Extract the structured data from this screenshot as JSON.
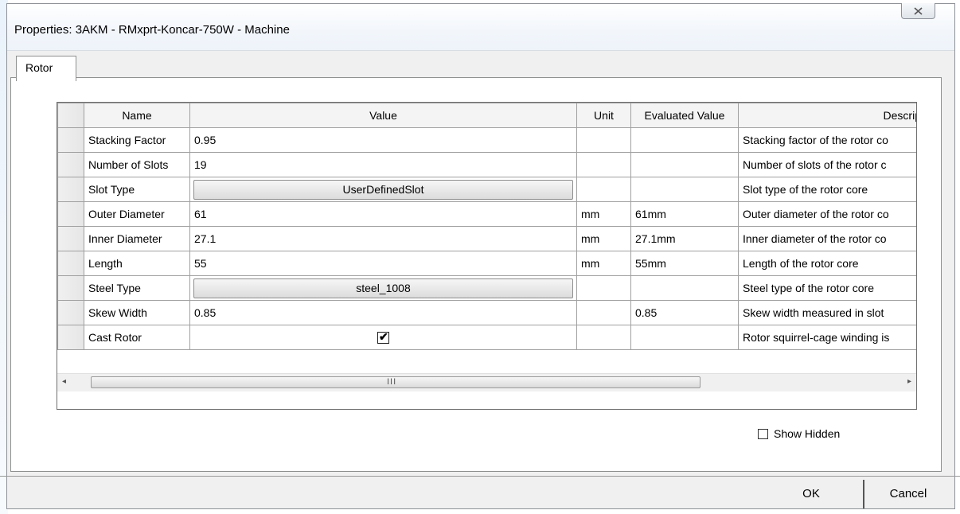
{
  "window": {
    "title": "Properties: 3AKM - RMxprt-Koncar-750W - Machine",
    "close_icon": "close-icon"
  },
  "tabs": [
    {
      "label": "Rotor",
      "active": true
    }
  ],
  "grid": {
    "columns": [
      "Name",
      "Value",
      "Unit",
      "Evaluated Value",
      "Descrip"
    ],
    "rows": [
      {
        "name": "Stacking Factor",
        "value": "0.95",
        "unit": "",
        "evaluated": "",
        "description": "Stacking factor of the rotor co"
      },
      {
        "name": "Number of Slots",
        "value": "19",
        "unit": "",
        "evaluated": "",
        "description": "Number of slots of the rotor c"
      },
      {
        "name": "Slot Type",
        "value": "UserDefinedSlot",
        "unit": "",
        "evaluated": "",
        "description": "Slot type of the rotor core"
      },
      {
        "name": "Outer Diameter",
        "value": "61",
        "unit": "mm",
        "evaluated": "61mm",
        "description": "Outer diameter of the rotor co"
      },
      {
        "name": "Inner Diameter",
        "value": "27.1",
        "unit": "mm",
        "evaluated": "27.1mm",
        "description": "Inner diameter of the rotor co"
      },
      {
        "name": "Length",
        "value": "55",
        "unit": "mm",
        "evaluated": "55mm",
        "description": "Length of the rotor core"
      },
      {
        "name": "Steel Type",
        "value": "steel_1008",
        "unit": "",
        "evaluated": "",
        "description": "Steel type of the rotor core"
      },
      {
        "name": "Skew Width",
        "value": "0.85",
        "unit": "",
        "evaluated": "0.85",
        "description": "Skew width measured in slot"
      },
      {
        "name": "Cast Rotor",
        "value": "✔",
        "unit": "",
        "evaluated": "",
        "description": "Rotor squirrel-cage winding is"
      }
    ],
    "scrollbar": {
      "left_arrow": "◂",
      "right_arrow": "▸",
      "grip": "III"
    }
  },
  "show_hidden": {
    "label": "Show Hidden",
    "checked": false
  },
  "buttons": {
    "ok": "OK",
    "cancel": "Cancel"
  }
}
